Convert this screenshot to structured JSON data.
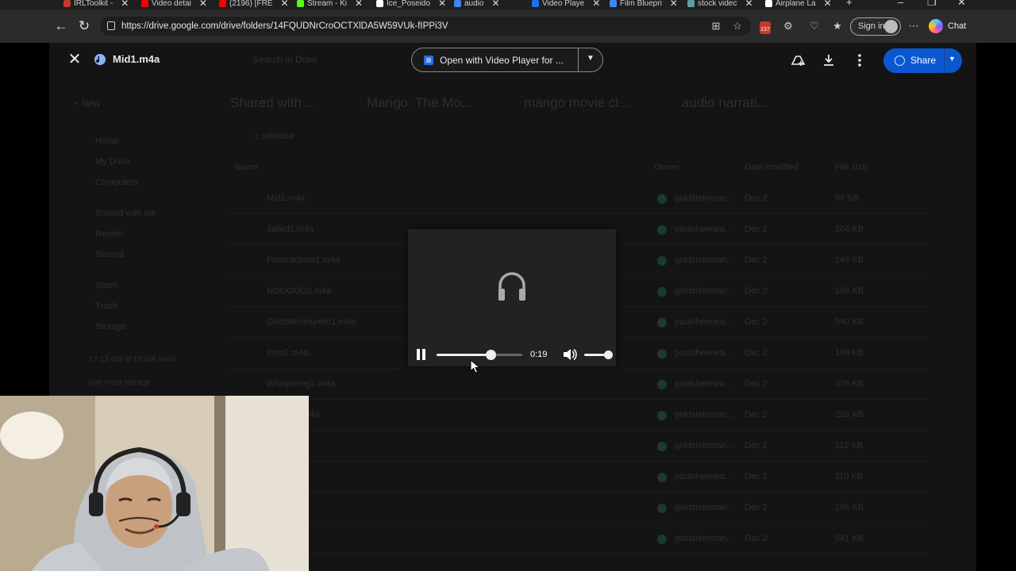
{
  "browser": {
    "tabs": [
      {
        "label": "IRLToolkit -",
        "color": "#c0392b"
      },
      {
        "label": "Video detai",
        "color": "#ff0000"
      },
      {
        "label": "(2196) [FRE",
        "color": "#ff0000"
      },
      {
        "label": "Stream - Ki",
        "color": "#53fc18"
      },
      {
        "label": "Ice_Poseido",
        "color": "#ffffff"
      },
      {
        "label": "audio",
        "color": "#4285f4"
      },
      {
        "label": "Video Playe",
        "color": "#1a73e8"
      },
      {
        "label": "Film Bluepri",
        "color": "#4285f4"
      },
      {
        "label": "stock videc",
        "color": "#5f9ea0"
      },
      {
        "label": "Airplane La",
        "color": "#ffffff"
      }
    ],
    "url": "https://drive.google.com/drive/folders/14FQUDNrCroOCTXlDA5W59VUk-fIPPi3V",
    "extension_badge": "137",
    "signin_label": "Sign in",
    "chat_label": "Chat"
  },
  "viewer": {
    "file_name": "Mid1.m4a",
    "open_with_label": "Open with Video Player for ...",
    "share_label": "Share"
  },
  "player": {
    "time": "0:19",
    "progress": 0.63,
    "volume": 1.0,
    "state": "playing"
  },
  "background": {
    "new_label": "New",
    "search_placeholder": "Search in Drive",
    "breadcrumb": [
      "Shared with ...",
      "Mango: The Mo...",
      "mango movie cl...",
      "audio narrati..."
    ],
    "selection": "1 selected",
    "nav": [
      "Home",
      "My Drive",
      "Computers",
      "Shared with me",
      "Recent",
      "Starred",
      "Spam",
      "Trash",
      "Storage"
    ],
    "storage_text": "17.13 GB of 15 GB used",
    "storage_button": "Get more storage",
    "columns": [
      "Name",
      "Owner",
      "Date modified",
      "File size"
    ],
    "files": [
      "Mid1.m4a",
      "Jailed1.m4a",
      "Posttrackout1.m4a",
      "NOOOOO2.m4a",
      "Goldsteinmurder1.m4a",
      "Intro2.m4a",
      "Whispering1.m4a",
      "...ughts1.m4a",
      "...",
      "...01.m4a",
      "...1.m4a",
      "...ut7.m4a"
    ],
    "owners": [
      "goldsteinman...",
      "paulsheenea...",
      "goldsteinman...",
      "goldsteinman...",
      "paulsheenea...",
      "paulsheenea...",
      "paulsheenea...",
      "goldsteinman...",
      "goldsteinman...",
      "paulsheenea...",
      "goldsteinman...",
      "goldsteinman..."
    ],
    "dates": [
      "Dec 2",
      "Dec 2",
      "Dec 2",
      "Dec 2",
      "Dec 2",
      "Dec 2",
      "Dec 2",
      "Dec 2",
      "Dec 2",
      "Dec 2",
      "Dec 2",
      "Dec 2"
    ],
    "sizes": [
      "86 KB",
      "204 KB",
      "146 KB",
      "108 KB",
      "540 KB",
      "198 KB",
      "376 KB",
      "226 KB",
      "112 KB",
      "110 KB",
      "196 KB",
      "541 KB"
    ]
  }
}
